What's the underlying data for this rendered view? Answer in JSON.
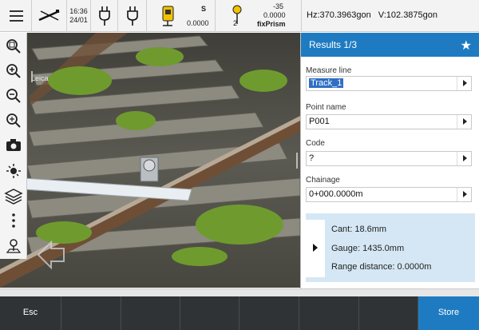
{
  "status_bar": {
    "time": "16:36",
    "date": "24/01",
    "instrument": {
      "line1": "S",
      "line2": "0.0000"
    },
    "prism": {
      "count": "2",
      "line1": "-35",
      "line2": "0.0000",
      "type": "fixPrism"
    },
    "hz": "Hz:370.3963gon",
    "v": "V:102.3875gon"
  },
  "viewport": {
    "label": "Leica"
  },
  "panel": {
    "title": "Results 1/3",
    "fields": [
      {
        "label": "Measure line",
        "value": "Track_1"
      },
      {
        "label": "Point name",
        "value": "P001"
      },
      {
        "label": "Code",
        "value": "?"
      },
      {
        "label": "Chainage",
        "value": "0+000.0000m"
      }
    ],
    "results": {
      "cant": "Cant: 18.6mm",
      "gauge": "Gauge: 1435.0mm",
      "range": "Range distance: 0.0000m"
    }
  },
  "softkeys": {
    "esc": "Esc",
    "store": "Store"
  },
  "colors": {
    "accent": "#1f7bc1",
    "softkey_bar": "#303336",
    "info_box": "#d5e7f4"
  }
}
